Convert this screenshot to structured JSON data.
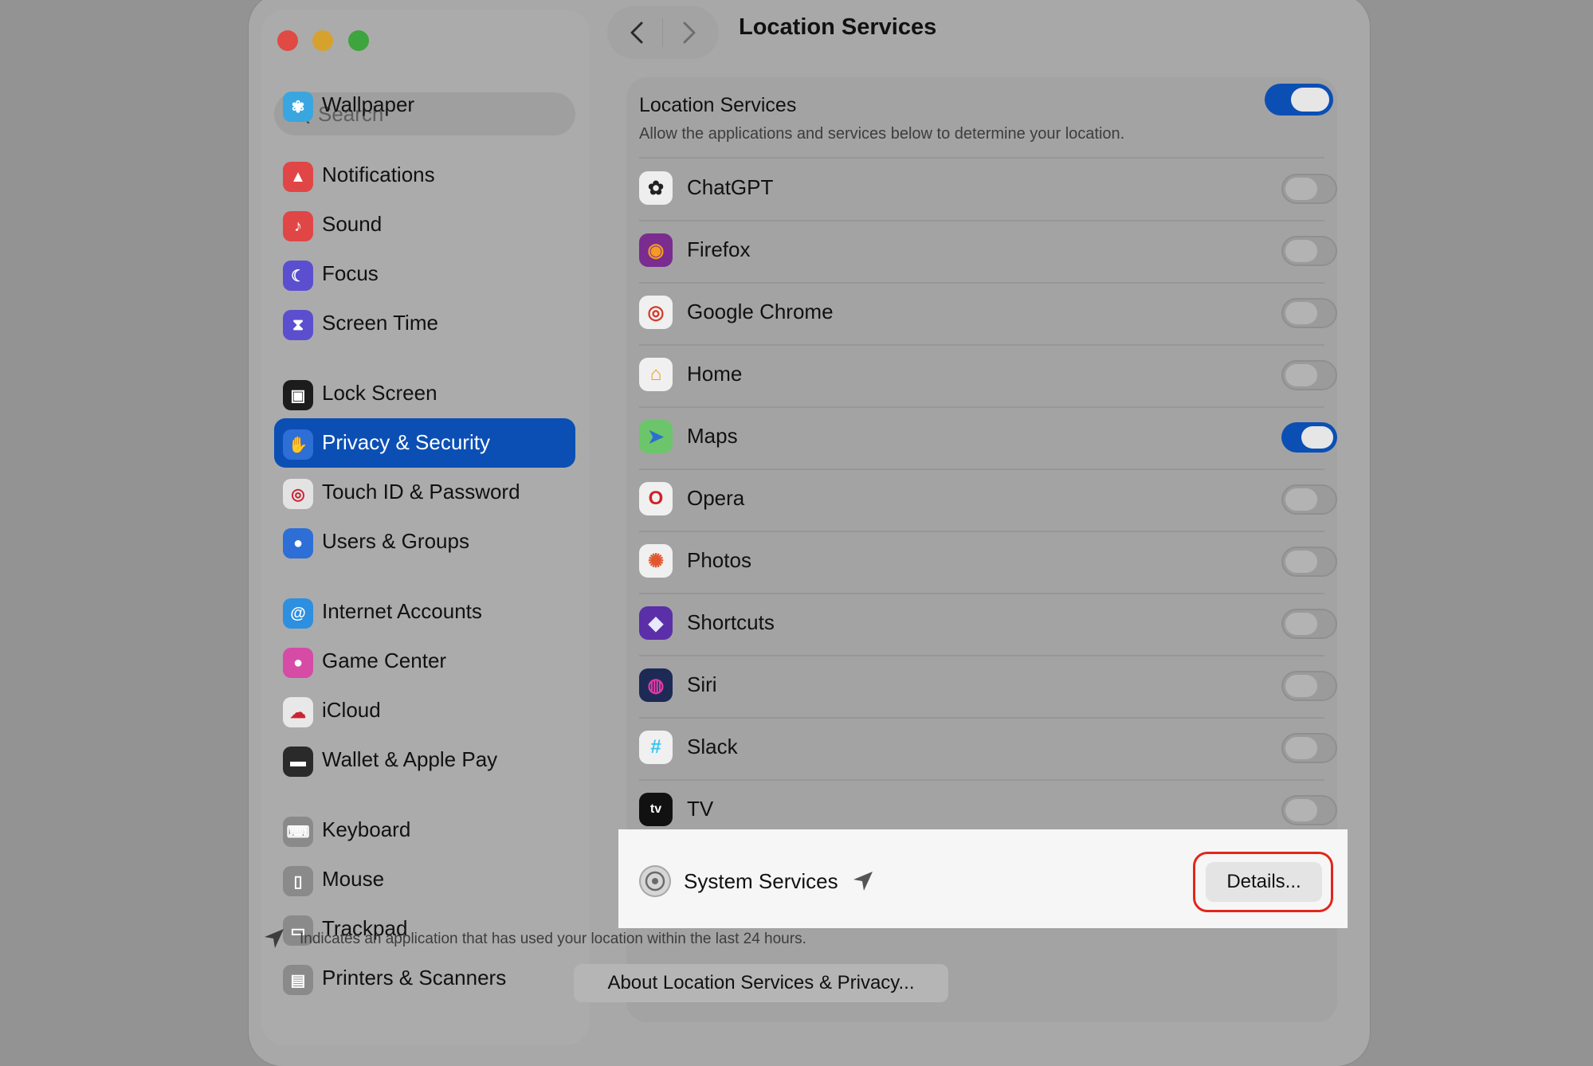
{
  "header": {
    "title": "Location Services"
  },
  "sidebar": {
    "search_placeholder": "Search",
    "items": [
      {
        "label": "Wallpaper",
        "icon": "wallpaper-icon",
        "color": "#3aa6e0",
        "active": false
      },
      {
        "label": "Notifications",
        "icon": "notifications-icon",
        "color": "#e14646",
        "active": false
      },
      {
        "label": "Sound",
        "icon": "sound-icon",
        "color": "#e14646",
        "active": false
      },
      {
        "label": "Focus",
        "icon": "focus-icon",
        "color": "#5b4fcf",
        "active": false
      },
      {
        "label": "Screen Time",
        "icon": "screen-time-icon",
        "color": "#5b4fcf",
        "active": false
      },
      {
        "label": "Lock Screen",
        "icon": "lock-screen-icon",
        "color": "#1c1c1c",
        "active": false
      },
      {
        "label": "Privacy & Security",
        "icon": "privacy-security-icon",
        "color": "#2d6fd6",
        "active": true
      },
      {
        "label": "Touch ID & Password",
        "icon": "touch-id-icon",
        "color": "#e3e3e3",
        "active": false
      },
      {
        "label": "Users & Groups",
        "icon": "users-groups-icon",
        "color": "#2d6fd6",
        "active": false
      },
      {
        "label": "Internet Accounts",
        "icon": "internet-accounts-icon",
        "color": "#2d8fe0",
        "active": false
      },
      {
        "label": "Game Center",
        "icon": "game-center-icon",
        "color": "#d64ba6",
        "active": false
      },
      {
        "label": "iCloud",
        "icon": "icloud-icon",
        "color": "#e8e8e8",
        "active": false
      },
      {
        "label": "Wallet & Apple Pay",
        "icon": "wallet-icon",
        "color": "#2a2a2a",
        "active": false
      },
      {
        "label": "Keyboard",
        "icon": "keyboard-icon",
        "color": "#8a8a8a",
        "active": false
      },
      {
        "label": "Mouse",
        "icon": "mouse-icon",
        "color": "#8a8a8a",
        "active": false
      },
      {
        "label": "Trackpad",
        "icon": "trackpad-icon",
        "color": "#8a8a8a",
        "active": false
      },
      {
        "label": "Printers & Scanners",
        "icon": "printers-scanners-icon",
        "color": "#8a8a8a",
        "active": false
      }
    ]
  },
  "location_services": {
    "title": "Location Services",
    "description": "Allow the applications and services below to determine your location.",
    "enabled": true
  },
  "apps": [
    {
      "name": "ChatGPT",
      "icon": "chatgpt-icon",
      "color": "#eeeeee",
      "enabled": false
    },
    {
      "name": "Firefox",
      "icon": "firefox-icon",
      "color": "#7a2c8f",
      "enabled": false
    },
    {
      "name": "Google Chrome",
      "icon": "chrome-icon",
      "color": "#f0f0f0",
      "enabled": false
    },
    {
      "name": "Home",
      "icon": "home-icon",
      "color": "#f0f0f0",
      "enabled": false
    },
    {
      "name": "Maps",
      "icon": "maps-icon",
      "color": "#6cc56a",
      "enabled": true
    },
    {
      "name": "Opera",
      "icon": "opera-icon",
      "color": "#f0f0f0",
      "enabled": false
    },
    {
      "name": "Photos",
      "icon": "photos-icon",
      "color": "#f0f0f0",
      "enabled": false
    },
    {
      "name": "Shortcuts",
      "icon": "shortcuts-icon",
      "color": "#5b2fa8",
      "enabled": false
    },
    {
      "name": "Siri",
      "icon": "siri-icon",
      "color": "#1d2a55",
      "enabled": false
    },
    {
      "name": "Slack",
      "icon": "slack-icon",
      "color": "#f0f0f0",
      "enabled": false
    },
    {
      "name": "TV",
      "icon": "tv-icon",
      "color": "#111111",
      "enabled": false
    }
  ],
  "system_services": {
    "label": "System Services",
    "details_button": "Details..."
  },
  "footer": {
    "note": "Indicates an application that has used your location within the last 24 hours.",
    "about_button": "About Location Services & Privacy..."
  },
  "colors": {
    "accent": "#0b4fb4",
    "highlight_ring": "#e3261a"
  }
}
